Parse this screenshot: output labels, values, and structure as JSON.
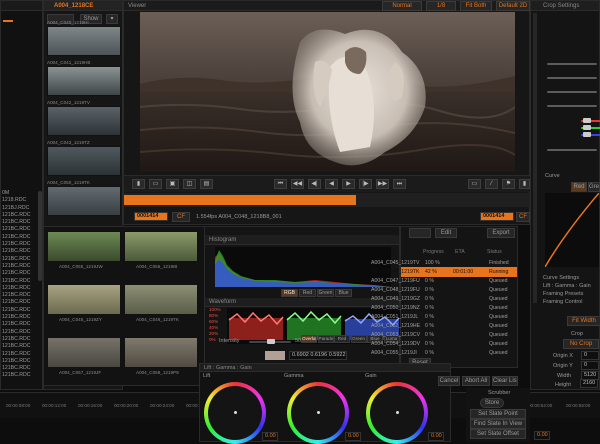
{
  "left_list": {
    "items": [
      "0M",
      "1218.RDC",
      "121BJ.RDC",
      "121BC.RDC",
      "121BC.RDC",
      "121BC.RDC",
      "121BC.RDC",
      "121BC.RDC",
      "121BC.RDC",
      "121BC.RDC",
      "121BC.RDC",
      "121BC.RDC",
      "121BC.RDC",
      "121BC.RDC",
      "121BC.RDC",
      "121BC.RDC",
      "121BC.RDC",
      "121BC.RDC",
      "121BC.RDC",
      "121BC.RDC",
      "121BC.RDC",
      "121BC.RDC",
      "121BC.RDC",
      "121BC.RDC",
      "121BC.RDC",
      "121BC.RDC"
    ]
  },
  "browser": {
    "title": "A004_1218CE",
    "show_label": "Show",
    "clips_top": [
      "A004_C040_1219HI",
      "A004_C041_1219HB",
      "A004_C042_1219TV",
      "A004_C043_1219TZ",
      "A004_C050_1219TK"
    ],
    "clips_grid": [
      [
        "A004_C055_1219JW",
        "A004_C056_1219IB"
      ],
      [
        "A004_C045_1219ZY",
        "A004_C046_1219TK"
      ],
      [
        "A004_C057_1219JF",
        "A004_C058_1219P9"
      ]
    ]
  },
  "viewer": {
    "title": "Viewer",
    "mode": "Normal",
    "ratio": "1/8",
    "fit": "Fit Both",
    "view": "Default 2D",
    "timecode_in": "0001414",
    "cf_label": "CF",
    "clip_info": "1.554fps A004_C048_1218B8_001",
    "timecode_out": "0001414",
    "progress": 0.57
  },
  "analysis": {
    "copy_label": "Copy",
    "edit_label": "Edit",
    "export_label": "Export",
    "histogram_title": "Histogram",
    "waveform_title": "Waveform",
    "hist_tabs": [
      "RGB",
      "Red",
      "Green",
      "Blue"
    ],
    "wave_labels": [
      "100%",
      "80%",
      "60%",
      "40%",
      "20%",
      "0%"
    ],
    "wave_tabs": [
      "Overlay",
      "Parade",
      "Red",
      "Green",
      "Blue",
      "Luma"
    ],
    "intensity_label": "Intensity",
    "intensity_value": "50",
    "readout": "0.6902 0.6196 0.5922"
  },
  "queue": {
    "columns": [
      "Name",
      "Progress",
      "ETA",
      "Status"
    ],
    "rows": [
      [
        "A004_C045_1219TV",
        "100 %",
        "",
        "Finished"
      ],
      [
        "A004_C046_1219TK",
        "42 %",
        "00:01:00",
        "Running"
      ],
      [
        "A004_C047_1219FU",
        "0 %",
        "",
        "Queued"
      ],
      [
        "A004_C048_1219FU",
        "0 %",
        "",
        "Queued"
      ],
      [
        "A004_C049_1219GZ",
        "0 %",
        "",
        "Queued"
      ],
      [
        "A004_C050_1219NZ",
        "0 %",
        "",
        "Queued"
      ],
      [
        "A004_C051_1219JL",
        "0 %",
        "",
        "Queued"
      ],
      [
        "A004_C052_1219HE",
        "0 %",
        "",
        "Queued"
      ],
      [
        "A004_C053_1219CV",
        "0 %",
        "",
        "Queued"
      ],
      [
        "A004_C054_1219DV",
        "0 %",
        "",
        "Queued"
      ],
      [
        "A004_C055_1219JI",
        "0 %",
        "",
        "Queued"
      ]
    ],
    "reset_label": "Reset",
    "cancel_label": "Cancel",
    "abort_label": "Abort All",
    "clear_label": "Clear List"
  },
  "grade": {
    "title": "Lift : Gamma : Gain",
    "wheels": [
      {
        "label": "Lift",
        "value": "0.00"
      },
      {
        "label": "Gamma",
        "value": "0.00"
      },
      {
        "label": "Gain",
        "value": "0.00"
      }
    ]
  },
  "scrubber": {
    "title": "Scrubber",
    "store_label": "Store",
    "buttons": [
      "Set Slate Point",
      "Find Slate In View",
      "Set Slate Offset"
    ],
    "value": "0.00"
  },
  "timeline": {
    "ticks_left": [
      "00:00:08:00",
      "00:00:12:00",
      "00:00:16:00",
      "00:00:20:00",
      "00:00:24:00",
      "00:00:28:00"
    ],
    "ticks_right": [
      "00:00:52:00",
      "00:00:56:00"
    ]
  },
  "inspector": {
    "title": "Crop Settings",
    "curve_label": "Curve",
    "curve_tabs": [
      "Red",
      "Green"
    ],
    "sections": [
      "Curve Settings",
      "Lift : Gamma : Gain",
      "Framing Presets",
      "Framing Control"
    ],
    "fit_width": "Fit Width",
    "crop_label": "Crop",
    "crop_value": "No Crop",
    "origin_x_label": "Origin X",
    "origin_x": "0",
    "origin_y_label": "Origin Y",
    "origin_y": "0",
    "width_label": "Width",
    "width_value": "5120",
    "height_label": "Height",
    "height_value": "2160"
  },
  "colors": {
    "accent": "#e8741b",
    "panel": "#161616",
    "bg": "#0d0d0d"
  }
}
